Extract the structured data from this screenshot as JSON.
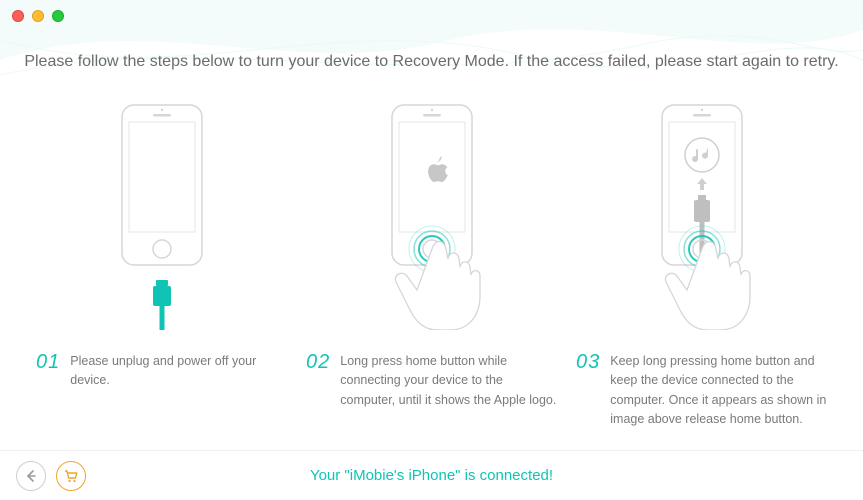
{
  "colors": {
    "accent": "#10c4b5",
    "cart": "#f0a62c",
    "text_muted": "#7a7a7a"
  },
  "header": {
    "instruction": "Please follow the steps below to turn your device to Recovery Mode. If the access failed, please start again to retry."
  },
  "steps": [
    {
      "num": "01",
      "text": "Please unplug and power off your device."
    },
    {
      "num": "02",
      "text": "Long press home button while connecting your device to the computer, until it shows the Apple logo."
    },
    {
      "num": "03",
      "text": "Keep long pressing home button and keep the device connected to the computer. Once it appears as shown in image above release home button."
    }
  ],
  "footer": {
    "status": "Your \"iMobie's iPhone\" is connected!",
    "back_icon": "arrow-left",
    "cart_icon": "shopping-cart"
  }
}
